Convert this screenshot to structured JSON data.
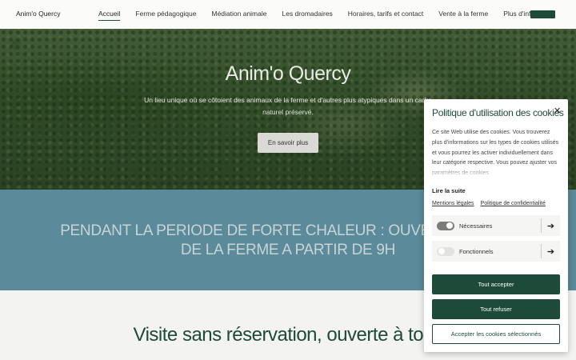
{
  "nav": {
    "brand": "Anim'o Quercy",
    "items": [
      {
        "label": "Accueil"
      },
      {
        "label": "Ferme pédagogique"
      },
      {
        "label": "Médiation animale"
      },
      {
        "label": "Les dromadaires"
      },
      {
        "label": "Horaires, tarifs et contact"
      },
      {
        "label": "Vente à la ferme"
      },
      {
        "label": "Plus d'infos"
      }
    ]
  },
  "hero": {
    "title": "Anim'o Quercy",
    "subtitle": "Un lieu unique où se côtoient des animaux de la ferme  et d'autres plus atypiques dans un cadre naturel préservé.",
    "button": "En savoir plus"
  },
  "banner": {
    "line1": "PENDANT LA PERIODE DE FORTE CHALEUR : OUVERTURE EXC",
    "line2": "DE LA FERME A PARTIR DE 9H"
  },
  "section": {
    "title": "Visite sans réservation, ouverte à tous"
  },
  "cookie": {
    "title": "Politique d'utilisation des cookies",
    "description": "Ce site Web utilise des cookies. Vous trouverez plus d'informations sur les types de cookies utilisés et vous pourrez les activer individuellement dans leur catégorie respective. Vous pouvez ajuster vos paramètres de cookies",
    "read_more": "Lire la suite",
    "link_legal": "Mentions légales",
    "link_privacy": "Politique de confidentialité",
    "categories": [
      {
        "label": "Nécessaires",
        "enabled": true
      },
      {
        "label": "Fonctionnels",
        "enabled": false
      }
    ],
    "accept_all": "Tout accepter",
    "refuse_all": "Tout refuser",
    "accept_selected": "Accepter les cookies sélectionnés"
  }
}
